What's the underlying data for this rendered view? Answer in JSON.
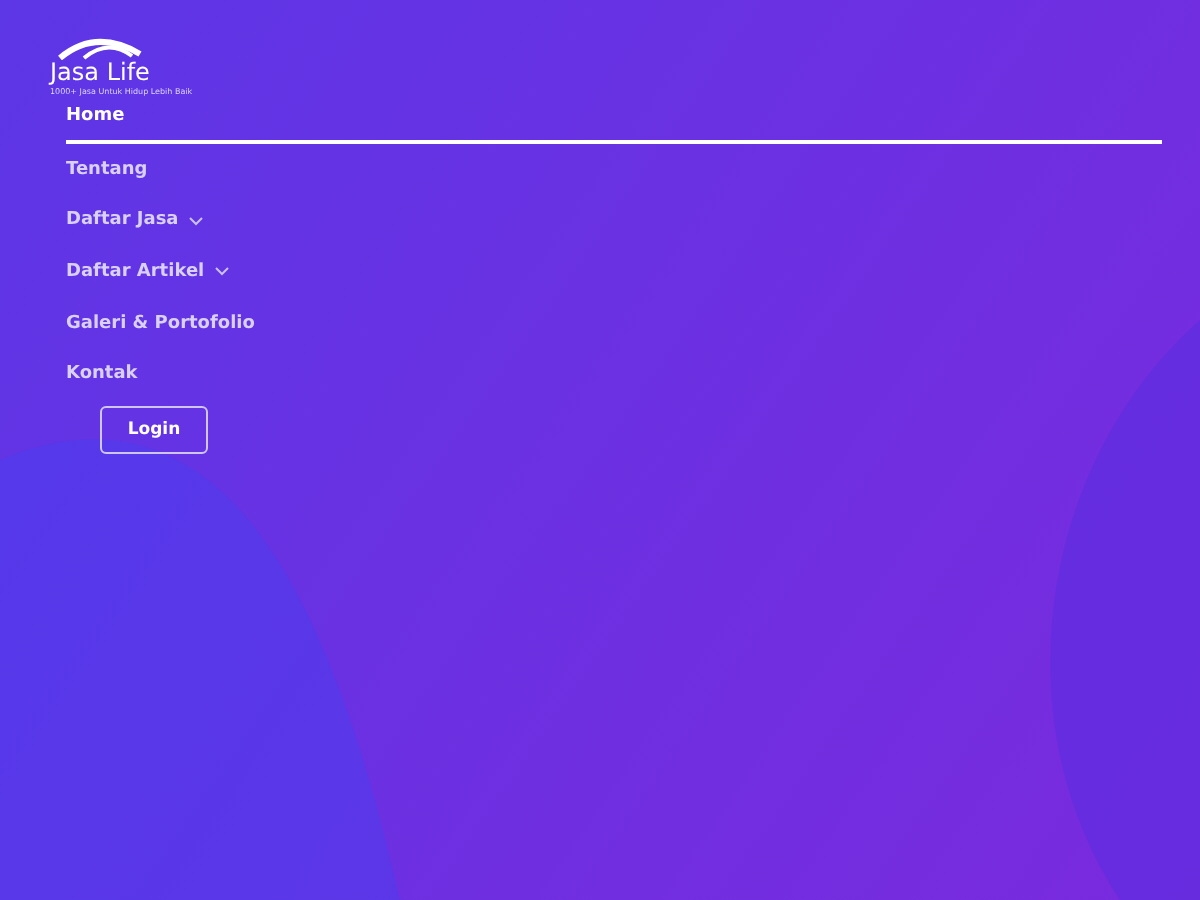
{
  "logo": {
    "name": "Jasa Life",
    "tagline": "1000+ Jasa Untuk Hidup Lebih Baik"
  },
  "nav": [
    {
      "label": "Home",
      "selected": true,
      "has_dropdown": false
    },
    {
      "label": "Tentang",
      "selected": false,
      "has_dropdown": false
    },
    {
      "label": "Daftar Jasa",
      "selected": false,
      "has_dropdown": true
    },
    {
      "label": "Daftar Artikel",
      "selected": false,
      "has_dropdown": true
    },
    {
      "label": "Galeri & Portofolio",
      "selected": false,
      "has_dropdown": false
    },
    {
      "label": "Kontak",
      "selected": false,
      "has_dropdown": false
    }
  ],
  "login_button": "Login"
}
